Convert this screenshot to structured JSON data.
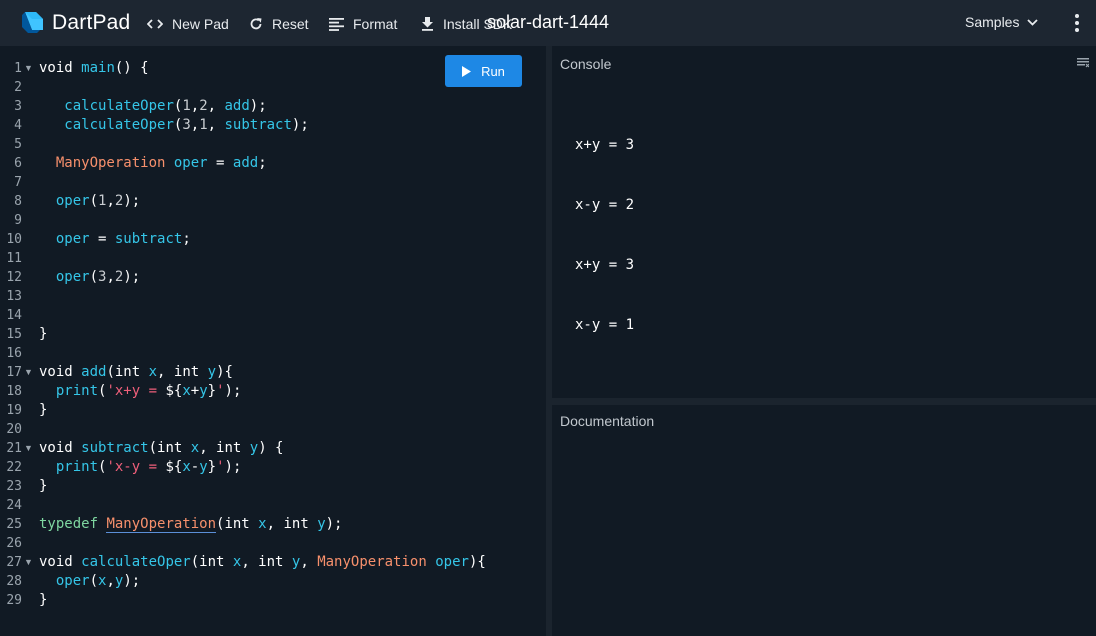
{
  "topbar": {
    "brand": "DartPad",
    "new_pad": "New Pad",
    "reset": "Reset",
    "format": "Format",
    "install_sdk": "Install SDK",
    "pad_title": "solar-dart-1444",
    "samples": "Samples"
  },
  "editor": {
    "run_label": "Run",
    "line_numbers": [
      "1",
      "2",
      "3",
      "4",
      "5",
      "6",
      "7",
      "8",
      "9",
      "10",
      "11",
      "12",
      "13",
      "14",
      "15",
      "16",
      "17",
      "18",
      "19",
      "20",
      "21",
      "22",
      "23",
      "24",
      "25",
      "26",
      "27",
      "28",
      "29"
    ],
    "folded_lines": [
      1,
      17,
      21,
      27
    ],
    "lines": [
      [
        [
          "kw",
          "void "
        ],
        [
          "fn",
          "main"
        ],
        [
          "kw",
          "() {"
        ]
      ],
      [],
      [
        [
          "kw",
          "   "
        ],
        [
          "fn",
          "calculateOper"
        ],
        [
          "kw",
          "("
        ],
        [
          "num",
          "1"
        ],
        [
          "kw",
          ","
        ],
        [
          "num",
          "2"
        ],
        [
          "kw",
          ", "
        ],
        [
          "id",
          "add"
        ],
        [
          "kw",
          ");"
        ]
      ],
      [
        [
          "kw",
          "   "
        ],
        [
          "fn",
          "calculateOper"
        ],
        [
          "kw",
          "("
        ],
        [
          "num",
          "3"
        ],
        [
          "kw",
          ","
        ],
        [
          "num",
          "1"
        ],
        [
          "kw",
          ", "
        ],
        [
          "id",
          "subtract"
        ],
        [
          "kw",
          ");"
        ]
      ],
      [],
      [
        [
          "kw",
          "  "
        ],
        [
          "ty",
          "ManyOperation"
        ],
        [
          "kw",
          " "
        ],
        [
          "id",
          "oper"
        ],
        [
          "kw",
          " = "
        ],
        [
          "id",
          "add"
        ],
        [
          "kw",
          ";"
        ]
      ],
      [],
      [
        [
          "kw",
          "  "
        ],
        [
          "fn",
          "oper"
        ],
        [
          "kw",
          "("
        ],
        [
          "num",
          "1"
        ],
        [
          "kw",
          ","
        ],
        [
          "num",
          "2"
        ],
        [
          "kw",
          ");"
        ]
      ],
      [],
      [
        [
          "kw",
          "  "
        ],
        [
          "id",
          "oper"
        ],
        [
          "kw",
          " = "
        ],
        [
          "id",
          "subtract"
        ],
        [
          "kw",
          ";"
        ]
      ],
      [],
      [
        [
          "kw",
          "  "
        ],
        [
          "fn",
          "oper"
        ],
        [
          "kw",
          "("
        ],
        [
          "num",
          "3"
        ],
        [
          "kw",
          ","
        ],
        [
          "num",
          "2"
        ],
        [
          "kw",
          ");"
        ]
      ],
      [],
      [],
      [
        [
          "kw",
          "}"
        ]
      ],
      [],
      [
        [
          "kw",
          "void "
        ],
        [
          "fn",
          "add"
        ],
        [
          "kw",
          "(int "
        ],
        [
          "id",
          "x"
        ],
        [
          "kw",
          ", int "
        ],
        [
          "id",
          "y"
        ],
        [
          "kw",
          "){"
        ]
      ],
      [
        [
          "kw",
          "  "
        ],
        [
          "fn",
          "print"
        ],
        [
          "kw",
          "("
        ],
        [
          "str",
          "'x+y = "
        ],
        [
          "kw",
          "${"
        ],
        [
          "id",
          "x"
        ],
        [
          "kw",
          "+"
        ],
        [
          "id",
          "y"
        ],
        [
          "kw",
          "}"
        ],
        [
          "str",
          "'"
        ],
        [
          "kw",
          ");"
        ]
      ],
      [
        [
          "kw",
          "}"
        ]
      ],
      [],
      [
        [
          "kw",
          "void "
        ],
        [
          "fn",
          "subtract"
        ],
        [
          "kw",
          "(int "
        ],
        [
          "id",
          "x"
        ],
        [
          "kw",
          ", int "
        ],
        [
          "id",
          "y"
        ],
        [
          "kw",
          ") {"
        ]
      ],
      [
        [
          "kw",
          "  "
        ],
        [
          "fn",
          "print"
        ],
        [
          "kw",
          "("
        ],
        [
          "str",
          "'x-y = "
        ],
        [
          "kw",
          "${"
        ],
        [
          "id",
          "x"
        ],
        [
          "kw",
          "-"
        ],
        [
          "id",
          "y"
        ],
        [
          "kw",
          "}"
        ],
        [
          "str",
          "'"
        ],
        [
          "kw",
          ");"
        ]
      ],
      [
        [
          "kw",
          "}"
        ]
      ],
      [],
      [
        [
          "td",
          "typedef "
        ],
        [
          "ty under",
          "ManyOperation"
        ],
        [
          "kw",
          "(int "
        ],
        [
          "id",
          "x"
        ],
        [
          "kw",
          ", int "
        ],
        [
          "id",
          "y"
        ],
        [
          "kw",
          ");"
        ]
      ],
      [],
      [
        [
          "kw",
          "void "
        ],
        [
          "fn",
          "calculateOper"
        ],
        [
          "kw",
          "(int "
        ],
        [
          "id",
          "x"
        ],
        [
          "kw",
          ", int "
        ],
        [
          "id",
          "y"
        ],
        [
          "kw",
          ", "
        ],
        [
          "ty",
          "ManyOperation"
        ],
        [
          "kw",
          " "
        ],
        [
          "id",
          "oper"
        ],
        [
          "kw",
          "){"
        ]
      ],
      [
        [
          "kw",
          "  "
        ],
        [
          "fn",
          "oper"
        ],
        [
          "kw",
          "("
        ],
        [
          "id",
          "x"
        ],
        [
          "kw",
          ","
        ],
        [
          "id",
          "y"
        ],
        [
          "kw",
          ");"
        ]
      ],
      [
        [
          "kw",
          "}"
        ]
      ]
    ]
  },
  "console": {
    "title": "Console",
    "output": [
      "x+y = 3",
      "x-y = 2",
      "x+y = 3",
      "x-y = 1"
    ]
  },
  "documentation": {
    "title": "Documentation"
  }
}
